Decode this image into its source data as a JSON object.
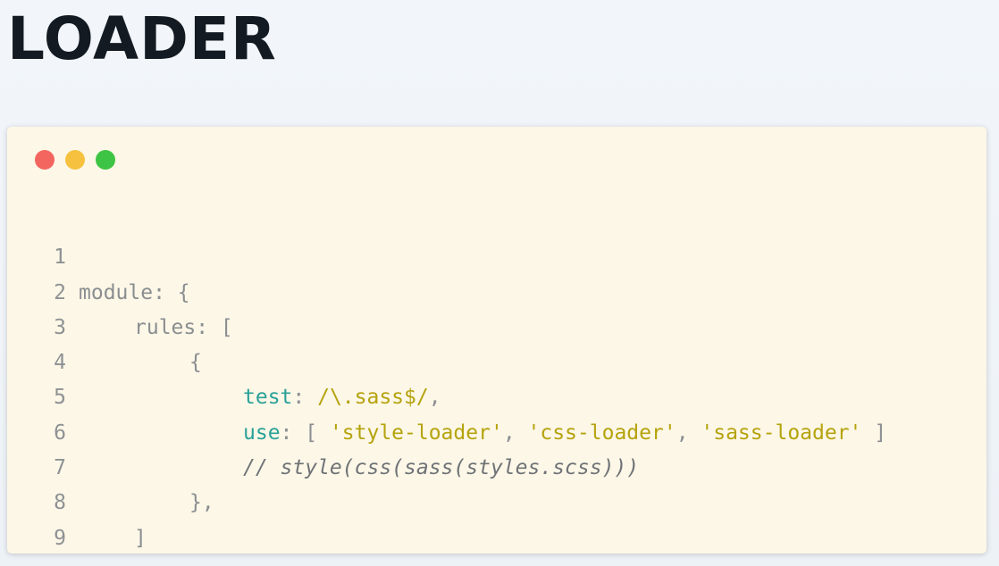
{
  "slide": {
    "title": "LOADER"
  },
  "window": {
    "controls": {
      "close_color": "#f2665f",
      "minimize_color": "#f6c13e",
      "maximize_color": "#3ec444"
    }
  },
  "code": {
    "lines": [
      {
        "number": "1",
        "text": "module: {"
      },
      {
        "number": "2",
        "text": "rules: ["
      },
      {
        "number": "3",
        "text": "{"
      },
      {
        "number": "4",
        "key": "test",
        "colon": ": ",
        "value": "/\\.sass$/",
        "tail": ","
      },
      {
        "number": "5",
        "key": "use",
        "colon": ": [ ",
        "values": [
          "'style-loader'",
          "'css-loader'",
          "'sass-loader'"
        ],
        "sep": ", ",
        "tail": " ]"
      },
      {
        "number": "6",
        "comment": "// style(css(sass(styles.scss)))"
      },
      {
        "number": "7",
        "text": "},"
      },
      {
        "number": "8",
        "text": "]"
      },
      {
        "number": "9",
        "text": "}"
      }
    ]
  },
  "colors": {
    "keyword": "#2aa198",
    "string": "#b5a30d",
    "plain": "#8a8e91",
    "background": "#fdf7e7"
  }
}
